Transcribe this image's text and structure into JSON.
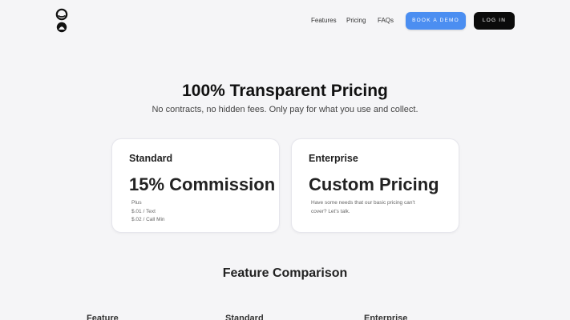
{
  "header": {
    "logo_icon": "hourglass-logo-icon",
    "nav": [
      {
        "label": "Features"
      },
      {
        "label": "Pricing"
      },
      {
        "label": "FAQs"
      }
    ],
    "demo_button": "BOOK A DEMO",
    "login_button": "LOG IN"
  },
  "hero": {
    "title": "100% Transparent Pricing",
    "subtitle": "No contracts, no hidden fees. Only pay for what you use and collect."
  },
  "plans": [
    {
      "name": "Standard",
      "price": "15% Commission",
      "lines": [
        "Plus",
        "$.01 / Text",
        "$.02 / Call Min"
      ]
    },
    {
      "name": "Enterprise",
      "price": "Custom Pricing",
      "description": "Have some needs that our basic pricing can't cover? Let's talk."
    }
  ],
  "comparison": {
    "title": "Feature Comparison",
    "columns": [
      "Feature",
      "Standard",
      "Enterprise"
    ]
  },
  "colors": {
    "background": "#f5f5f7",
    "accent": "#4b8ef1",
    "dark_button": "#0b0b0b"
  }
}
